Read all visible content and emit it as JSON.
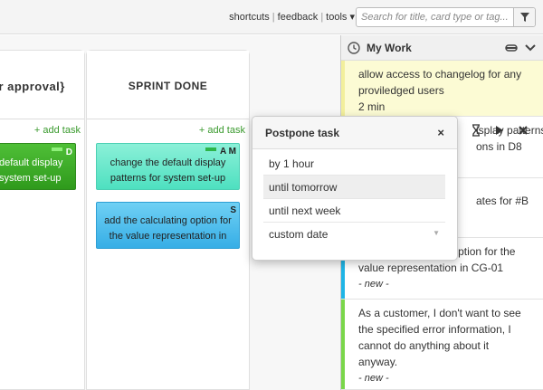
{
  "toplinks": {
    "shortcuts": "shortcuts",
    "feedback": "feedback",
    "tools": "tools ▾"
  },
  "search": {
    "placeholder": "Search for title, card type or tag..."
  },
  "board": {
    "columns": [
      {
        "title": "or approval}",
        "add_task": "+ add task"
      },
      {
        "title": "SPRINT DONE",
        "add_task": "+ add task"
      }
    ],
    "cards": [
      {
        "text_line1": "default display",
        "text_line2": "system set-up",
        "badge": "D",
        "color": "#3aa827"
      },
      {
        "text_line1": "change the default display",
        "text_line2": "patterns for system set-up",
        "badge": "A M",
        "color": "#6ae8cc"
      },
      {
        "text_line1": "add the calculating option for",
        "text_line2": "the value representation in",
        "badge": "S",
        "color": "#4cbdee"
      }
    ]
  },
  "mywork": {
    "title": "My Work",
    "tasks": [
      {
        "line1": "allow access to changelog for any",
        "line2": "proviledged users",
        "line3": "2 min"
      },
      {
        "line1": "isplay patterns",
        "line2": "ons in D8"
      },
      {
        "line1": "ates for #B"
      },
      {
        "line1": "add the calculating option for the",
        "line2": "value representation in CG-01",
        "status": "- new -"
      },
      {
        "line1": "As a customer, I don't want to see",
        "line2": "the specified error information, I",
        "line3": "cannot do anything about it",
        "line4": "anyway.",
        "status": "- new -"
      }
    ]
  },
  "popup": {
    "title": "Postpone task",
    "close": "×",
    "options": [
      "by 1 hour",
      "until tomorrow",
      "until next week",
      "custom date"
    ]
  },
  "colors": {
    "accent_green": "#3a9a2e",
    "highlight": "#eeeeee"
  }
}
